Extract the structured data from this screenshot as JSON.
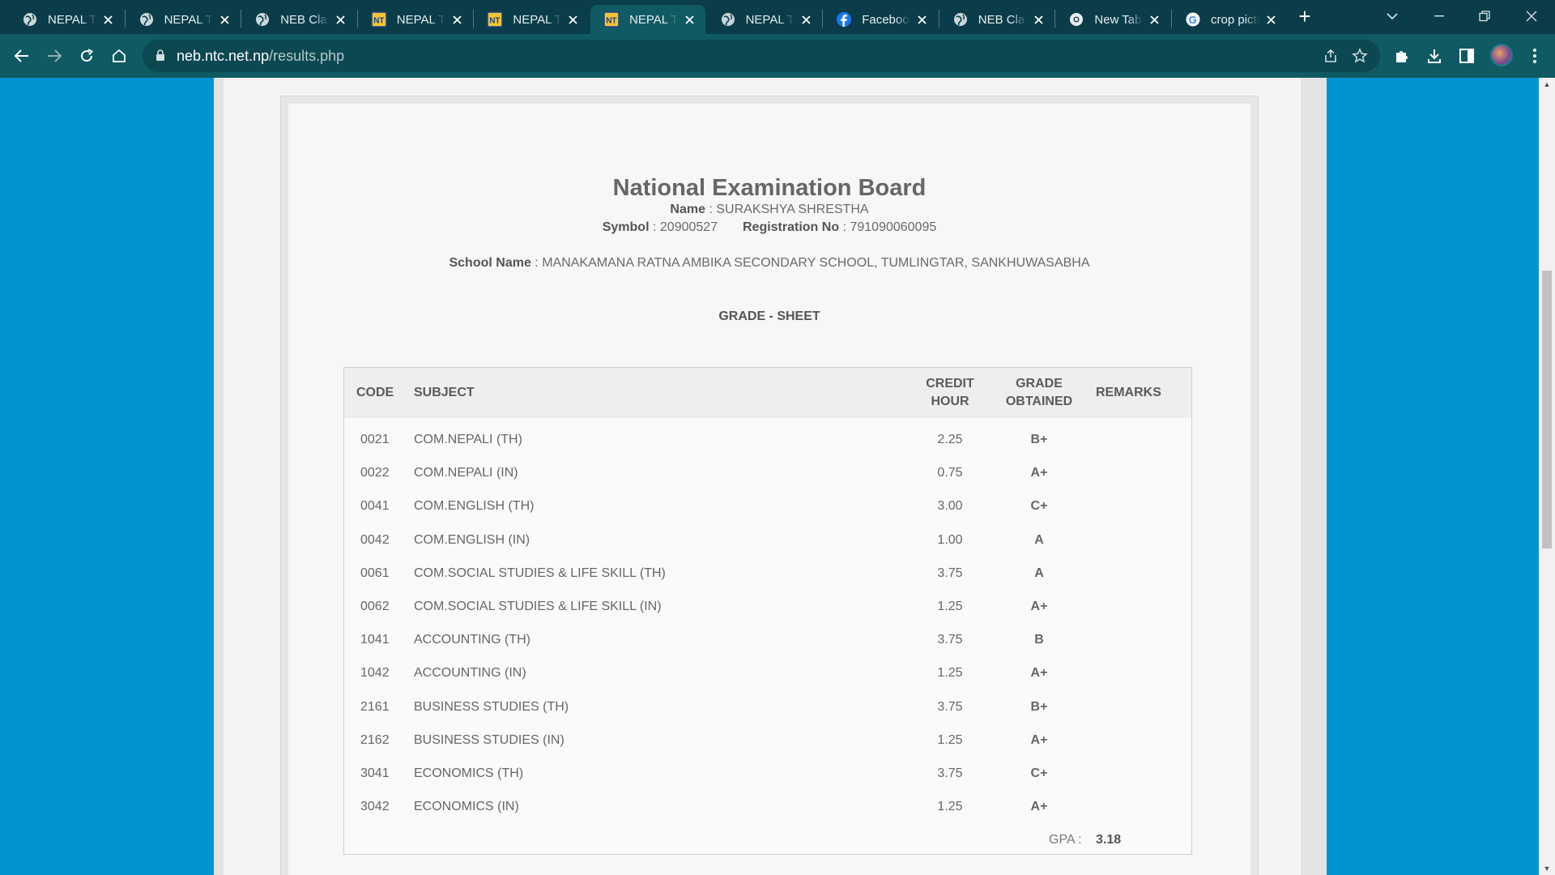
{
  "browser": {
    "tabs": [
      {
        "label": "NEPAL TE",
        "icon": "globe-icon"
      },
      {
        "label": "NEPAL TE",
        "icon": "globe-icon"
      },
      {
        "label": "NEB Class",
        "icon": "globe-icon"
      },
      {
        "label": "NEPAL TE",
        "icon": "nt-logo-icon"
      },
      {
        "label": "NEPAL TE",
        "icon": "nt-logo-icon"
      },
      {
        "label": "NEPAL TE",
        "icon": "nt-logo-icon",
        "active": true
      },
      {
        "label": "NEPAL TE",
        "icon": "globe-icon"
      },
      {
        "label": "Facebook",
        "icon": "facebook-icon"
      },
      {
        "label": "NEB Class",
        "icon": "globe-icon"
      },
      {
        "label": "New Tab",
        "icon": "chrome-icon"
      },
      {
        "label": "crop pictu",
        "icon": "google-icon"
      }
    ],
    "new_tab": "+",
    "url_host": "neb.ntc.net.np",
    "url_path": "/results.php"
  },
  "result": {
    "title": "National Examination Board",
    "name_label": "Name",
    "name_value": "SURAKSHYA SHRESTHA",
    "symbol_label": "Symbol",
    "symbol_value": "20900527",
    "reg_label": "Registration No",
    "reg_value": "791090060095",
    "school_label": "School Name",
    "school_value": "MANAKAMANA RATNA AMBIKA SECONDARY SCHOOL, TUMLINGTAR, SANKHUWASABHA",
    "sheet_title": "GRADE - SHEET",
    "separator": ":"
  },
  "table": {
    "headers": {
      "code": "CODE",
      "subject": "SUBJECT",
      "credit_1": "CREDIT",
      "credit_2": "HOUR",
      "grade_1": "GRADE",
      "grade_2": "OBTAINED",
      "remarks": "REMARKS"
    },
    "rows": [
      {
        "code": "0021",
        "subject": "COM.NEPALI (TH)",
        "credit": "2.25",
        "grade": "B+",
        "remarks": ""
      },
      {
        "code": "0022",
        "subject": "COM.NEPALI (IN)",
        "credit": "0.75",
        "grade": "A+",
        "remarks": ""
      },
      {
        "code": "0041",
        "subject": "COM.ENGLISH (TH)",
        "credit": "3.00",
        "grade": "C+",
        "remarks": ""
      },
      {
        "code": "0042",
        "subject": "COM.ENGLISH (IN)",
        "credit": "1.00",
        "grade": "A",
        "remarks": ""
      },
      {
        "code": "0061",
        "subject": "COM.SOCIAL STUDIES & LIFE SKILL (TH)",
        "credit": "3.75",
        "grade": "A",
        "remarks": ""
      },
      {
        "code": "0062",
        "subject": "COM.SOCIAL STUDIES & LIFE SKILL (IN)",
        "credit": "1.25",
        "grade": "A+",
        "remarks": ""
      },
      {
        "code": "1041",
        "subject": "ACCOUNTING (TH)",
        "credit": "3.75",
        "grade": "B",
        "remarks": ""
      },
      {
        "code": "1042",
        "subject": "ACCOUNTING (IN)",
        "credit": "1.25",
        "grade": "A+",
        "remarks": ""
      },
      {
        "code": "2161",
        "subject": "BUSINESS STUDIES (TH)",
        "credit": "3.75",
        "grade": "B+",
        "remarks": ""
      },
      {
        "code": "2162",
        "subject": "BUSINESS STUDIES (IN)",
        "credit": "1.25",
        "grade": "A+",
        "remarks": ""
      },
      {
        "code": "3041",
        "subject": "ECONOMICS (TH)",
        "credit": "3.75",
        "grade": "C+",
        "remarks": ""
      },
      {
        "code": "3042",
        "subject": "ECONOMICS (IN)",
        "credit": "1.25",
        "grade": "A+",
        "remarks": ""
      }
    ],
    "gpa_label": "GPA :",
    "gpa_value": "3.18"
  },
  "colors": {
    "page_background": "#0193cf",
    "tabbar": "#0a3d49",
    "toolbar": "#0f5a63"
  }
}
